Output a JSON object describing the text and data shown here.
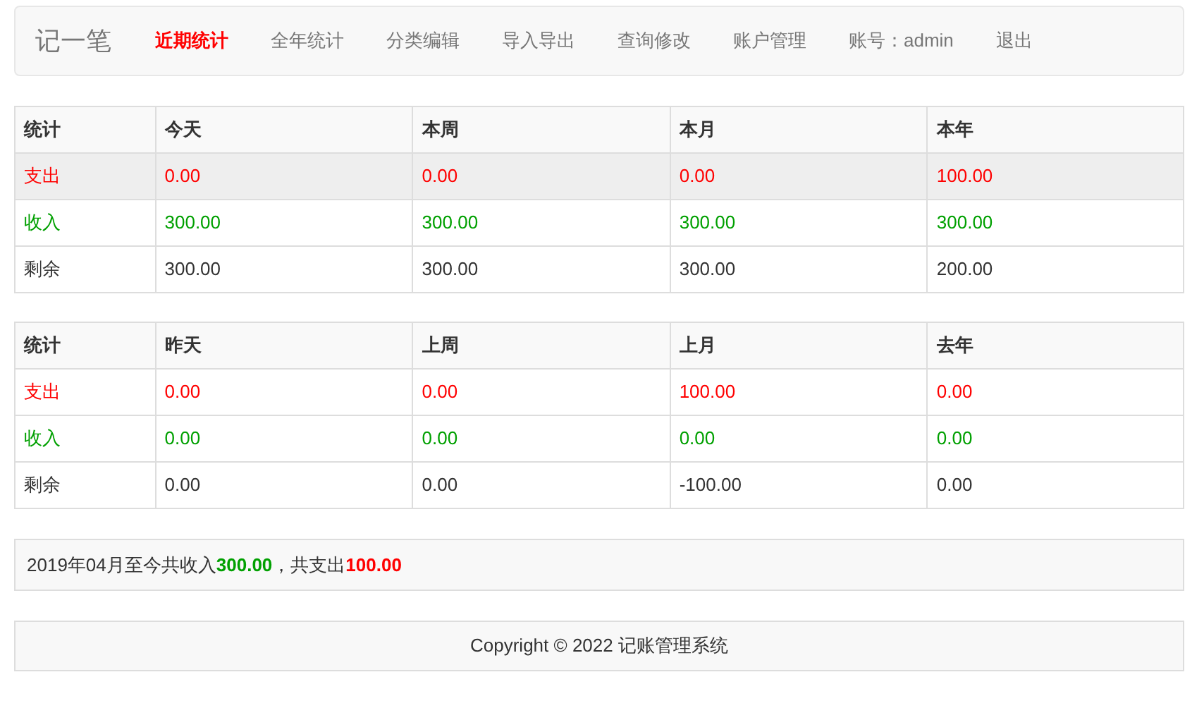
{
  "navbar": {
    "brand": "记一笔",
    "items": [
      {
        "label": "近期统计",
        "selected": true
      },
      {
        "label": "全年统计",
        "selected": false
      },
      {
        "label": "分类编辑",
        "selected": false
      },
      {
        "label": "导入导出",
        "selected": false
      },
      {
        "label": "查询修改",
        "selected": false
      },
      {
        "label": "账户管理",
        "selected": false
      },
      {
        "label": "账号：admin",
        "selected": false
      },
      {
        "label": "退出",
        "selected": false
      }
    ]
  },
  "tables": [
    {
      "columns": [
        "统计",
        "今天",
        "本周",
        "本月",
        "本年"
      ],
      "rows": [
        {
          "kind": "expense",
          "highlighted": true,
          "cells": [
            "支出",
            "0.00",
            "0.00",
            "0.00",
            "100.00"
          ]
        },
        {
          "kind": "income",
          "highlighted": false,
          "cells": [
            "收入",
            "300.00",
            "300.00",
            "300.00",
            "300.00"
          ]
        },
        {
          "kind": "balance",
          "highlighted": false,
          "cells": [
            "剩余",
            "300.00",
            "300.00",
            "300.00",
            "200.00"
          ]
        }
      ]
    },
    {
      "columns": [
        "统计",
        "昨天",
        "上周",
        "上月",
        "去年"
      ],
      "rows": [
        {
          "kind": "expense",
          "highlighted": false,
          "cells": [
            "支出",
            "0.00",
            "0.00",
            "100.00",
            "0.00"
          ]
        },
        {
          "kind": "income",
          "highlighted": false,
          "cells": [
            "收入",
            "0.00",
            "0.00",
            "0.00",
            "0.00"
          ]
        },
        {
          "kind": "balance",
          "highlighted": false,
          "cells": [
            "剩余",
            "0.00",
            "0.00",
            "-100.00",
            "0.00"
          ]
        }
      ]
    }
  ],
  "summary": [
    {
      "kind": "text",
      "text": "2019年04月至今共收入"
    },
    {
      "kind": "income",
      "text": "300.00"
    },
    {
      "kind": "text",
      "text": "，共支出"
    },
    {
      "kind": "expense",
      "text": "100.00"
    }
  ],
  "footer": "Copyright © 2022 记账管理系统"
}
